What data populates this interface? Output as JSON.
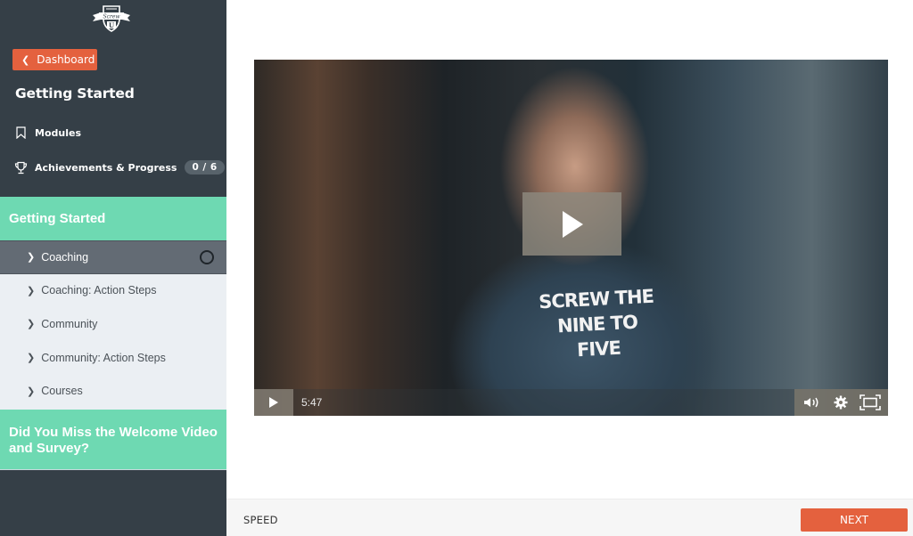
{
  "sidebar": {
    "logo_text": "Screw U",
    "dashboard_label": "Dashboard",
    "course_title": "Getting Started",
    "modules_label": "Modules",
    "achievements_label": "Achievements & Progress",
    "achievements_badge": "0 / 6",
    "sections": [
      {
        "title": "Getting Started",
        "lessons": [
          {
            "label": "Coaching",
            "active": true
          },
          {
            "label": "Coaching: Action Steps"
          },
          {
            "label": "Community"
          },
          {
            "label": "Community: Action Steps"
          },
          {
            "label": "Courses"
          }
        ]
      },
      {
        "title": "Did You Miss the Welcome Video and Survey?"
      }
    ]
  },
  "video": {
    "shirt_text": "SCREW THE NINE TO FIVE",
    "duration": "5:47"
  },
  "footer": {
    "speed_label": "SPEED",
    "next_label": "NEXT"
  },
  "colors": {
    "sidebar_bg": "#353f47",
    "accent_orange": "#e4613e",
    "section_green": "#6ed9b2",
    "active_lesson": "#636b74"
  }
}
